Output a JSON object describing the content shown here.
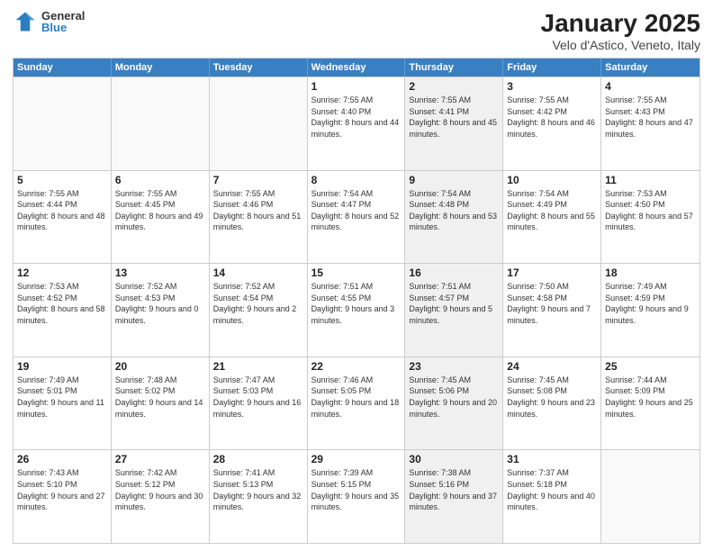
{
  "logo": {
    "general": "General",
    "blue": "Blue"
  },
  "title": "January 2025",
  "subtitle": "Velo d'Astico, Veneto, Italy",
  "weekdays": [
    "Sunday",
    "Monday",
    "Tuesday",
    "Wednesday",
    "Thursday",
    "Friday",
    "Saturday"
  ],
  "rows": [
    [
      {
        "day": "",
        "sunrise": "",
        "sunset": "",
        "daylight": "",
        "shaded": false,
        "empty": true
      },
      {
        "day": "",
        "sunrise": "",
        "sunset": "",
        "daylight": "",
        "shaded": false,
        "empty": true
      },
      {
        "day": "",
        "sunrise": "",
        "sunset": "",
        "daylight": "",
        "shaded": false,
        "empty": true
      },
      {
        "day": "1",
        "sunrise": "Sunrise: 7:55 AM",
        "sunset": "Sunset: 4:40 PM",
        "daylight": "Daylight: 8 hours and 44 minutes.",
        "shaded": false,
        "empty": false
      },
      {
        "day": "2",
        "sunrise": "Sunrise: 7:55 AM",
        "sunset": "Sunset: 4:41 PM",
        "daylight": "Daylight: 8 hours and 45 minutes.",
        "shaded": true,
        "empty": false
      },
      {
        "day": "3",
        "sunrise": "Sunrise: 7:55 AM",
        "sunset": "Sunset: 4:42 PM",
        "daylight": "Daylight: 8 hours and 46 minutes.",
        "shaded": false,
        "empty": false
      },
      {
        "day": "4",
        "sunrise": "Sunrise: 7:55 AM",
        "sunset": "Sunset: 4:43 PM",
        "daylight": "Daylight: 8 hours and 47 minutes.",
        "shaded": false,
        "empty": false
      }
    ],
    [
      {
        "day": "5",
        "sunrise": "Sunrise: 7:55 AM",
        "sunset": "Sunset: 4:44 PM",
        "daylight": "Daylight: 8 hours and 48 minutes.",
        "shaded": false,
        "empty": false
      },
      {
        "day": "6",
        "sunrise": "Sunrise: 7:55 AM",
        "sunset": "Sunset: 4:45 PM",
        "daylight": "Daylight: 8 hours and 49 minutes.",
        "shaded": false,
        "empty": false
      },
      {
        "day": "7",
        "sunrise": "Sunrise: 7:55 AM",
        "sunset": "Sunset: 4:46 PM",
        "daylight": "Daylight: 8 hours and 51 minutes.",
        "shaded": false,
        "empty": false
      },
      {
        "day": "8",
        "sunrise": "Sunrise: 7:54 AM",
        "sunset": "Sunset: 4:47 PM",
        "daylight": "Daylight: 8 hours and 52 minutes.",
        "shaded": false,
        "empty": false
      },
      {
        "day": "9",
        "sunrise": "Sunrise: 7:54 AM",
        "sunset": "Sunset: 4:48 PM",
        "daylight": "Daylight: 8 hours and 53 minutes.",
        "shaded": true,
        "empty": false
      },
      {
        "day": "10",
        "sunrise": "Sunrise: 7:54 AM",
        "sunset": "Sunset: 4:49 PM",
        "daylight": "Daylight: 8 hours and 55 minutes.",
        "shaded": false,
        "empty": false
      },
      {
        "day": "11",
        "sunrise": "Sunrise: 7:53 AM",
        "sunset": "Sunset: 4:50 PM",
        "daylight": "Daylight: 8 hours and 57 minutes.",
        "shaded": false,
        "empty": false
      }
    ],
    [
      {
        "day": "12",
        "sunrise": "Sunrise: 7:53 AM",
        "sunset": "Sunset: 4:52 PM",
        "daylight": "Daylight: 8 hours and 58 minutes.",
        "shaded": false,
        "empty": false
      },
      {
        "day": "13",
        "sunrise": "Sunrise: 7:52 AM",
        "sunset": "Sunset: 4:53 PM",
        "daylight": "Daylight: 9 hours and 0 minutes.",
        "shaded": false,
        "empty": false
      },
      {
        "day": "14",
        "sunrise": "Sunrise: 7:52 AM",
        "sunset": "Sunset: 4:54 PM",
        "daylight": "Daylight: 9 hours and 2 minutes.",
        "shaded": false,
        "empty": false
      },
      {
        "day": "15",
        "sunrise": "Sunrise: 7:51 AM",
        "sunset": "Sunset: 4:55 PM",
        "daylight": "Daylight: 9 hours and 3 minutes.",
        "shaded": false,
        "empty": false
      },
      {
        "day": "16",
        "sunrise": "Sunrise: 7:51 AM",
        "sunset": "Sunset: 4:57 PM",
        "daylight": "Daylight: 9 hours and 5 minutes.",
        "shaded": true,
        "empty": false
      },
      {
        "day": "17",
        "sunrise": "Sunrise: 7:50 AM",
        "sunset": "Sunset: 4:58 PM",
        "daylight": "Daylight: 9 hours and 7 minutes.",
        "shaded": false,
        "empty": false
      },
      {
        "day": "18",
        "sunrise": "Sunrise: 7:49 AM",
        "sunset": "Sunset: 4:59 PM",
        "daylight": "Daylight: 9 hours and 9 minutes.",
        "shaded": false,
        "empty": false
      }
    ],
    [
      {
        "day": "19",
        "sunrise": "Sunrise: 7:49 AM",
        "sunset": "Sunset: 5:01 PM",
        "daylight": "Daylight: 9 hours and 11 minutes.",
        "shaded": false,
        "empty": false
      },
      {
        "day": "20",
        "sunrise": "Sunrise: 7:48 AM",
        "sunset": "Sunset: 5:02 PM",
        "daylight": "Daylight: 9 hours and 14 minutes.",
        "shaded": false,
        "empty": false
      },
      {
        "day": "21",
        "sunrise": "Sunrise: 7:47 AM",
        "sunset": "Sunset: 5:03 PM",
        "daylight": "Daylight: 9 hours and 16 minutes.",
        "shaded": false,
        "empty": false
      },
      {
        "day": "22",
        "sunrise": "Sunrise: 7:46 AM",
        "sunset": "Sunset: 5:05 PM",
        "daylight": "Daylight: 9 hours and 18 minutes.",
        "shaded": false,
        "empty": false
      },
      {
        "day": "23",
        "sunrise": "Sunrise: 7:45 AM",
        "sunset": "Sunset: 5:06 PM",
        "daylight": "Daylight: 9 hours and 20 minutes.",
        "shaded": true,
        "empty": false
      },
      {
        "day": "24",
        "sunrise": "Sunrise: 7:45 AM",
        "sunset": "Sunset: 5:08 PM",
        "daylight": "Daylight: 9 hours and 23 minutes.",
        "shaded": false,
        "empty": false
      },
      {
        "day": "25",
        "sunrise": "Sunrise: 7:44 AM",
        "sunset": "Sunset: 5:09 PM",
        "daylight": "Daylight: 9 hours and 25 minutes.",
        "shaded": false,
        "empty": false
      }
    ],
    [
      {
        "day": "26",
        "sunrise": "Sunrise: 7:43 AM",
        "sunset": "Sunset: 5:10 PM",
        "daylight": "Daylight: 9 hours and 27 minutes.",
        "shaded": false,
        "empty": false
      },
      {
        "day": "27",
        "sunrise": "Sunrise: 7:42 AM",
        "sunset": "Sunset: 5:12 PM",
        "daylight": "Daylight: 9 hours and 30 minutes.",
        "shaded": false,
        "empty": false
      },
      {
        "day": "28",
        "sunrise": "Sunrise: 7:41 AM",
        "sunset": "Sunset: 5:13 PM",
        "daylight": "Daylight: 9 hours and 32 minutes.",
        "shaded": false,
        "empty": false
      },
      {
        "day": "29",
        "sunrise": "Sunrise: 7:39 AM",
        "sunset": "Sunset: 5:15 PM",
        "daylight": "Daylight: 9 hours and 35 minutes.",
        "shaded": false,
        "empty": false
      },
      {
        "day": "30",
        "sunrise": "Sunrise: 7:38 AM",
        "sunset": "Sunset: 5:16 PM",
        "daylight": "Daylight: 9 hours and 37 minutes.",
        "shaded": true,
        "empty": false
      },
      {
        "day": "31",
        "sunrise": "Sunrise: 7:37 AM",
        "sunset": "Sunset: 5:18 PM",
        "daylight": "Daylight: 9 hours and 40 minutes.",
        "shaded": false,
        "empty": false
      },
      {
        "day": "",
        "sunrise": "",
        "sunset": "",
        "daylight": "",
        "shaded": false,
        "empty": true
      }
    ]
  ]
}
